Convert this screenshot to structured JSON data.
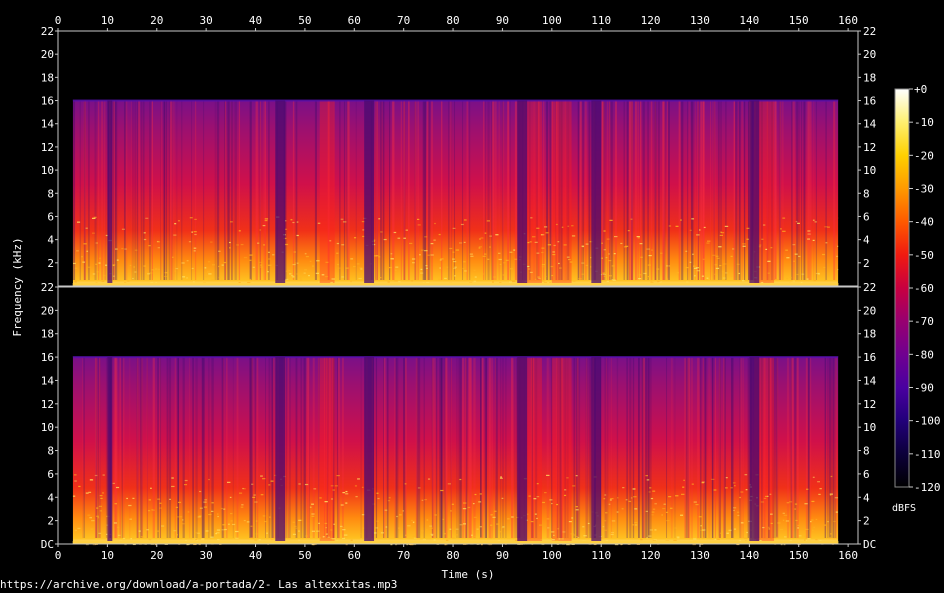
{
  "chart_data": {
    "type": "heatmap",
    "xlabel": "Time (s)",
    "ylabel": "Frequency (kHz)",
    "x_ticks": [
      0,
      10,
      20,
      30,
      40,
      50,
      60,
      70,
      80,
      90,
      100,
      110,
      120,
      130,
      140,
      150,
      160
    ],
    "xlim": [
      0,
      162
    ],
    "channels": [
      {
        "ylim": [
          0,
          22
        ],
        "y_tick_labels": [
          "22",
          "20",
          "18",
          "16",
          "14",
          "12",
          "10",
          "8",
          "6",
          "4",
          "2"
        ],
        "lowpass_cutoff_khz": 16
      },
      {
        "ylim": [
          0,
          22
        ],
        "y_tick_labels": [
          "22",
          "20",
          "18",
          "16",
          "14",
          "12",
          "10",
          "8",
          "6",
          "4",
          "2",
          "DC"
        ],
        "lowpass_cutoff_khz": 16
      }
    ],
    "colorbar": {
      "label": "dBFS",
      "range": [
        -120,
        0
      ],
      "tick_labels": [
        "+0",
        "-10",
        "-20",
        "-30",
        "-40",
        "-50",
        "-60",
        "-70",
        "-80",
        "-90",
        "-100",
        "-110",
        "-120"
      ],
      "colors": [
        "#ffffff",
        "#fff070",
        "#ffd000",
        "#ff9a00",
        "#ff5a00",
        "#f01a10",
        "#c80040",
        "#980070",
        "#700090",
        "#4a00a0",
        "#22007a",
        "#0c003a",
        "#000000"
      ]
    },
    "quiet_segments_s": [
      [
        0,
        3
      ],
      [
        10,
        11
      ],
      [
        44,
        46
      ],
      [
        62,
        64
      ],
      [
        93,
        95
      ],
      [
        108,
        110
      ],
      [
        140,
        142
      ],
      [
        158,
        162
      ]
    ],
    "bright_segments_s": [
      [
        53,
        56
      ],
      [
        93,
        98
      ],
      [
        100,
        104
      ],
      [
        141,
        145
      ]
    ]
  },
  "footer": {
    "source_text": "https://archive.org/download/a-portada/2- Las altexxitas.mp3"
  }
}
